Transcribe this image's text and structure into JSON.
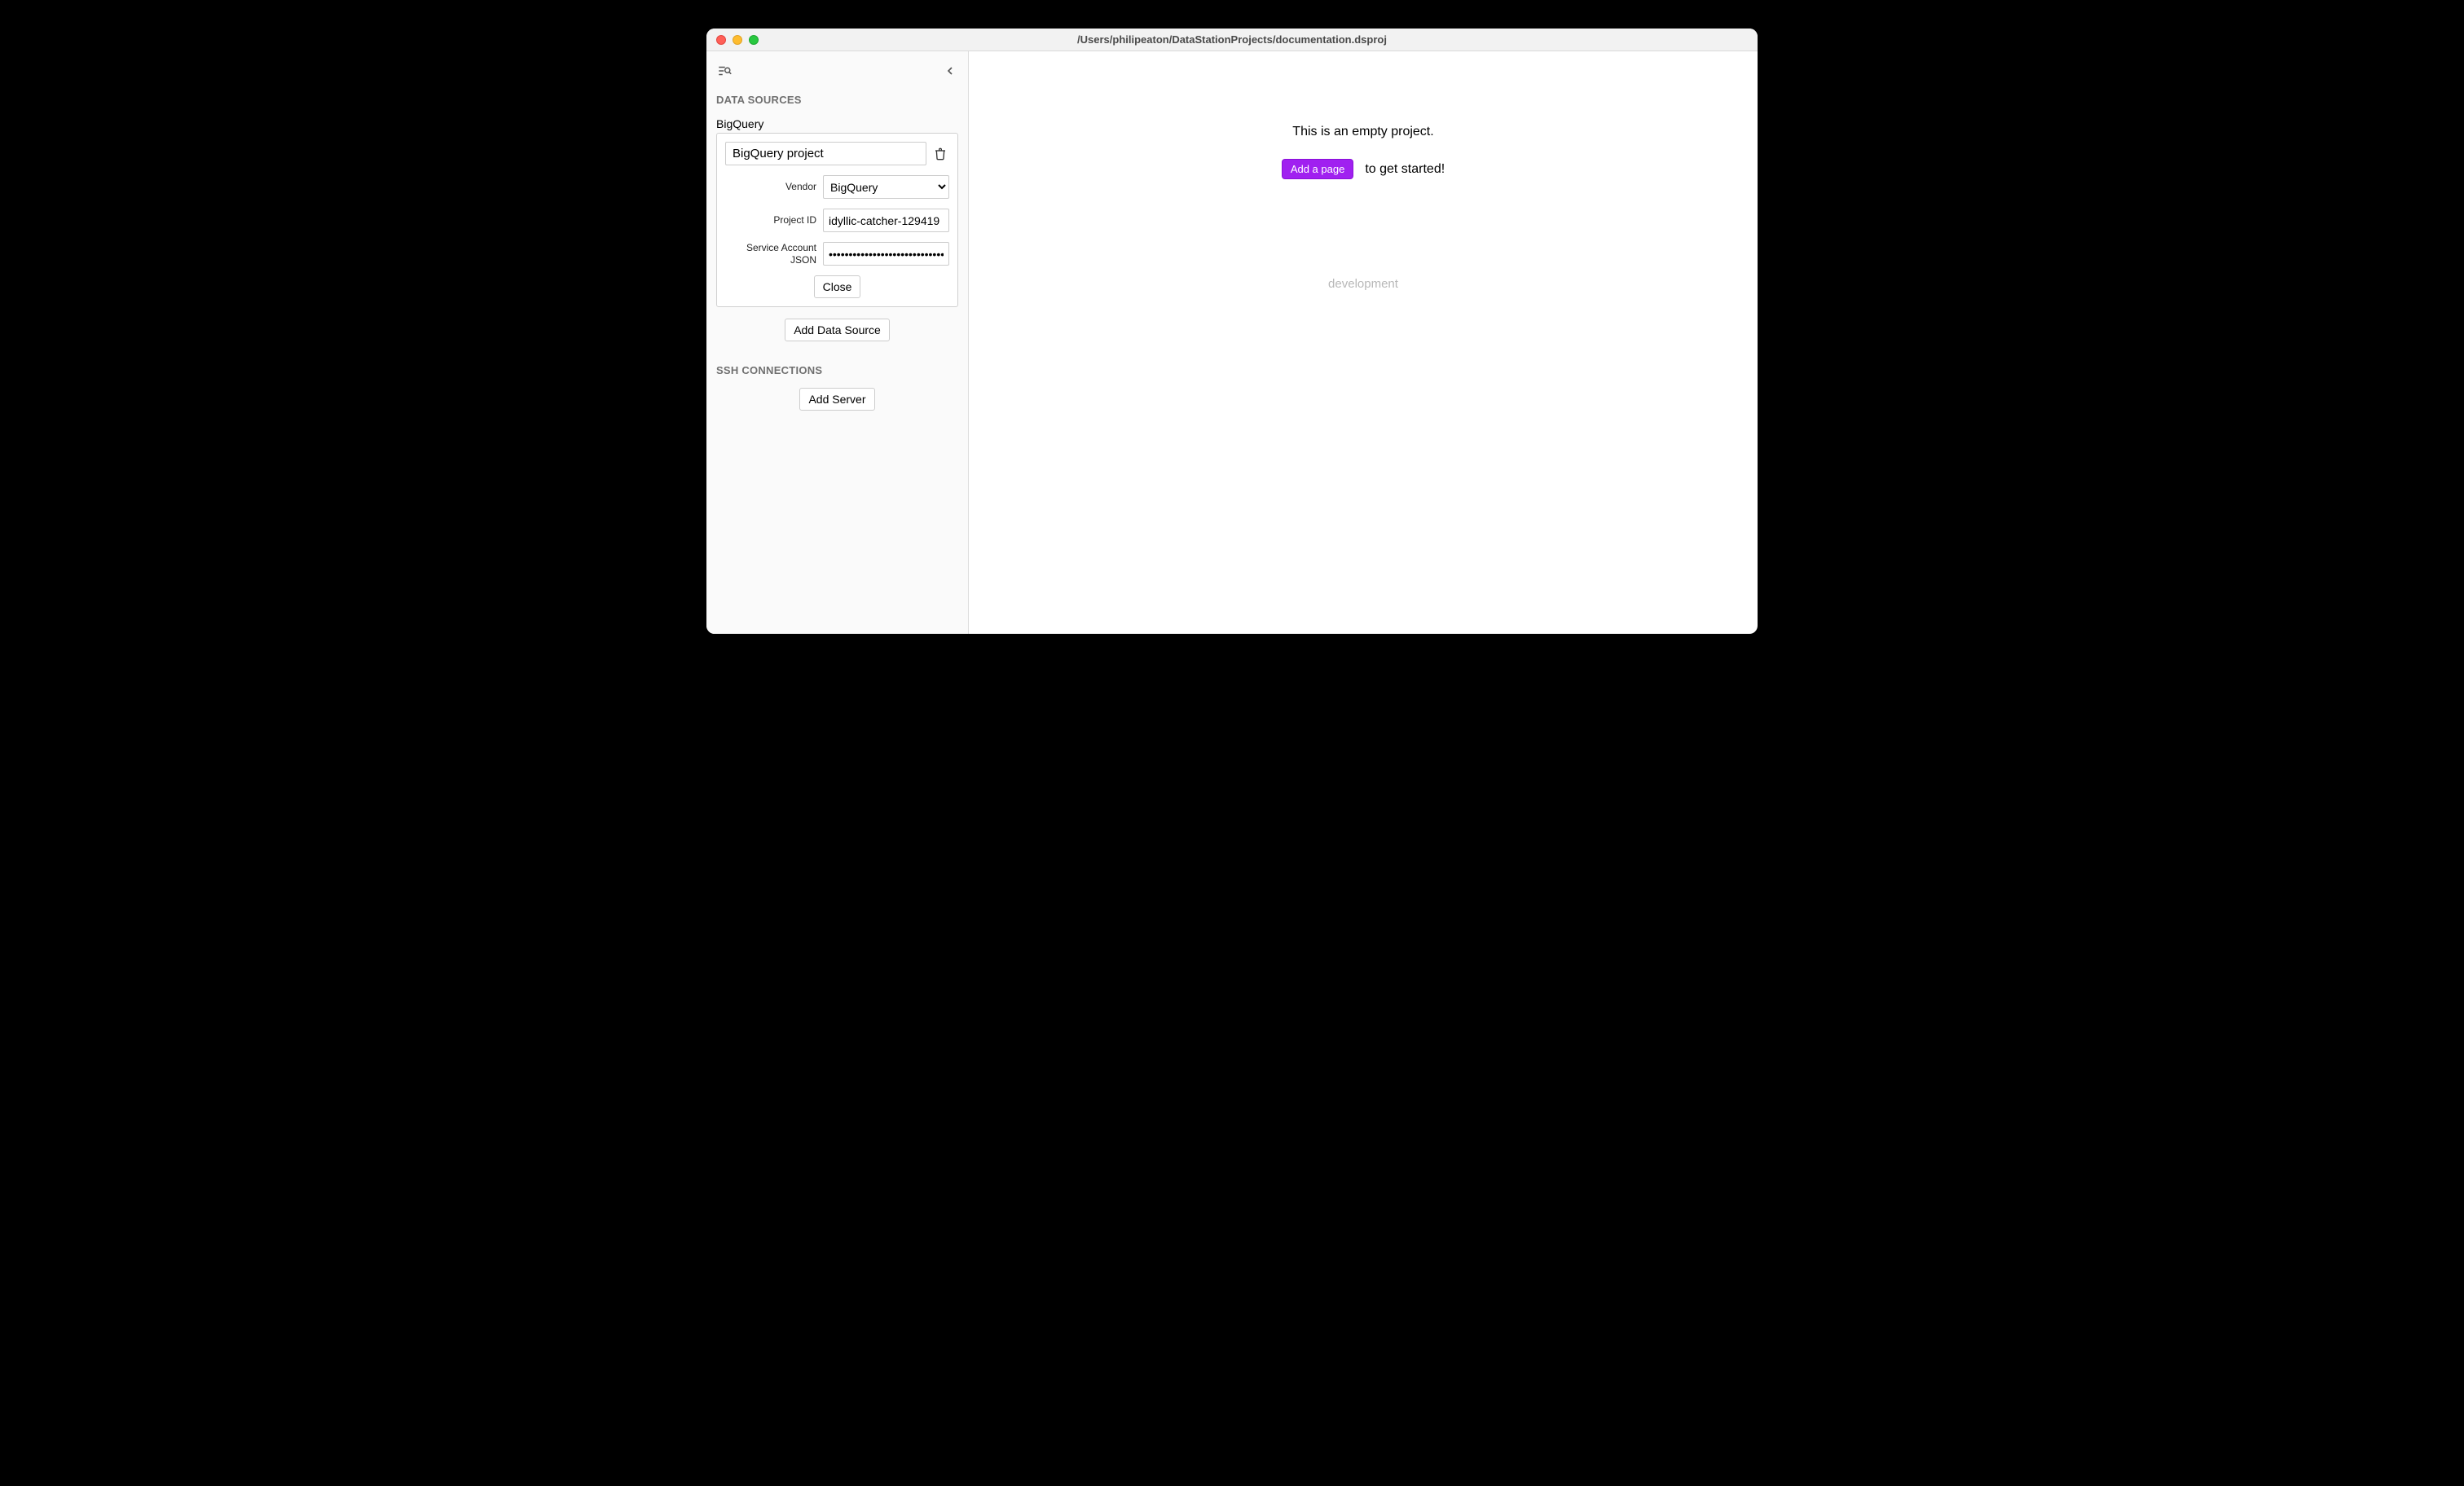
{
  "window": {
    "title": "/Users/philipeaton/DataStationProjects/documentation.dsproj"
  },
  "sidebar": {
    "sections": {
      "data_sources": {
        "header": "DATA SOURCES",
        "items": [
          {
            "name_label": "BigQuery",
            "name_value": "BigQuery project",
            "fields": {
              "vendor": {
                "label": "Vendor",
                "value": "BigQuery"
              },
              "project_id": {
                "label": "Project ID",
                "value": "idyllic-catcher-129419"
              },
              "service_account_json": {
                "label": "Service Account JSON",
                "value": "••••••••••••••••••••••••••••••"
              }
            },
            "close_label": "Close"
          }
        ],
        "add_button": "Add Data Source"
      },
      "ssh": {
        "header": "SSH CONNECTIONS",
        "add_button": "Add Server"
      }
    }
  },
  "main": {
    "empty_message": "This is an empty project.",
    "add_page_label": "Add a page",
    "get_started_suffix": "to get started!",
    "env_label": "development"
  }
}
